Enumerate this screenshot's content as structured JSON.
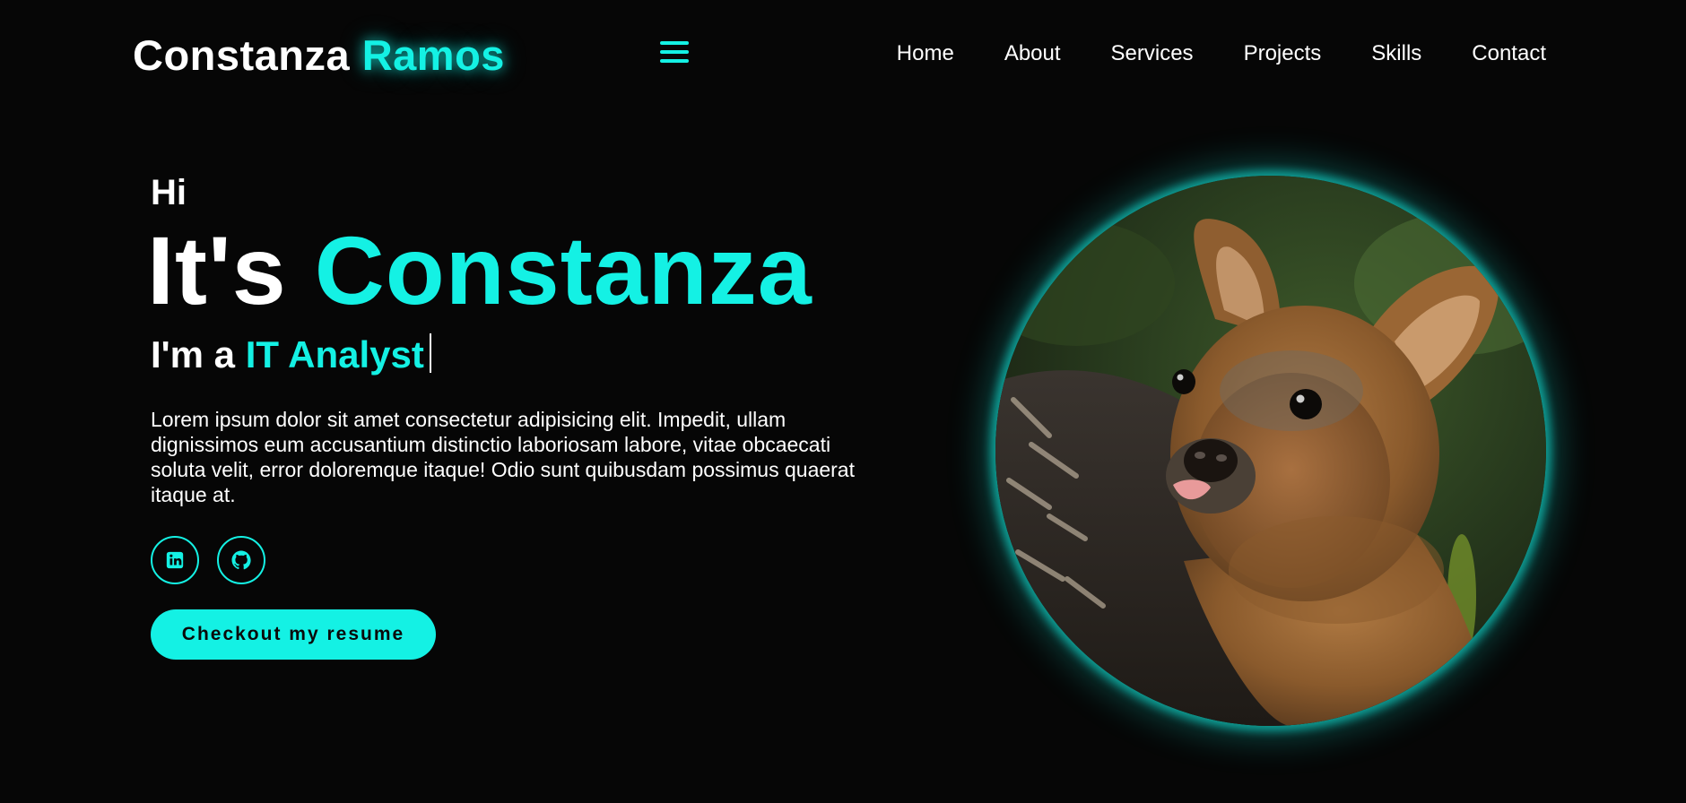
{
  "header": {
    "logo_first": "Constanza",
    "logo_last": "Ramos",
    "nav": [
      "Home",
      "About",
      "Services",
      "Projects",
      "Skills",
      "Contact"
    ]
  },
  "hero": {
    "greeting": "Hi",
    "headline_prefix": "It's",
    "headline_name": "Constanza",
    "role_prefix": "I'm a",
    "role_title": "IT Analyst",
    "bio": "Lorem ipsum dolor sit amet consectetur adipisicing elit. Impedit, ullam dignissimos eum accusantium distinctio laboriosam labore, vitae obcaecati soluta velit, error doloremque itaque! Odio sunt quibusdam possimus quaerat itaque at.",
    "socials": [
      {
        "icon": "linkedin-icon"
      },
      {
        "icon": "github-icon"
      }
    ],
    "cta_label": "Checkout my resume"
  },
  "portrait": {
    "subject": "young deer (pudu) photo",
    "ring_color": "#14f1e4"
  },
  "colors": {
    "background": "#060606",
    "accent": "#14f1e4",
    "text": "#ffffff"
  }
}
